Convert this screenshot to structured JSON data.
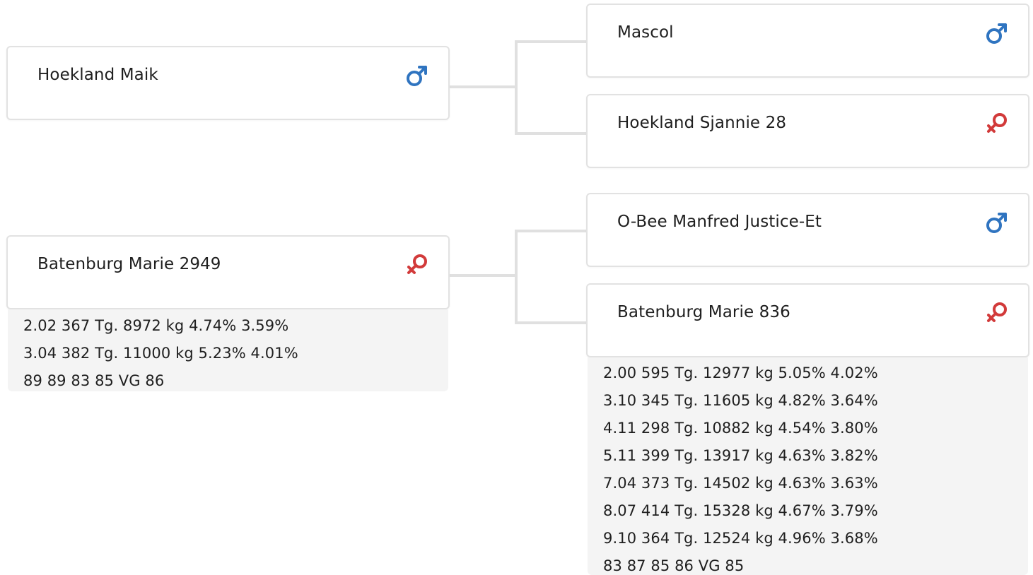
{
  "pedigree": {
    "sire": {
      "name": "Hoekland Maik",
      "sex_icon": "male-icon",
      "sire": {
        "name": "Mascol",
        "sex_icon": "male-icon"
      },
      "dam": {
        "name": "Hoekland Sjannie 28",
        "sex_icon": "female-icon"
      }
    },
    "dam": {
      "name": "Batenburg Marie 2949",
      "sex_icon": "female-icon",
      "stats": [
        "2.02 367 Tg. 8972 kg 4.74% 3.59%",
        "3.04 382 Tg. 11000 kg 5.23% 4.01%",
        "89 89 83 85 VG 86"
      ],
      "sire": {
        "name": "O-Bee Manfred Justice-Et",
        "sex_icon": "male-icon"
      },
      "dam": {
        "name": "Batenburg Marie 836",
        "sex_icon": "female-icon",
        "stats": [
          "2.00 595 Tg. 12977 kg 5.05% 4.02%",
          "3.10 345 Tg. 11605 kg 4.82% 3.64%",
          "4.11 298 Tg. 10882 kg 4.54% 3.80%",
          "5.11 399 Tg. 13917 kg 4.63% 3.82%",
          "7.04 373 Tg. 14502 kg 4.63% 3.63%",
          "8.07 414 Tg. 15328 kg 4.67% 3.79%",
          "9.10 364 Tg. 12524 kg 4.96% 3.68%",
          "83 87 85 86 VG 85"
        ]
      }
    }
  },
  "colors": {
    "male": "#2f74c0",
    "female": "#d23a3a",
    "border": "#e2e2e2",
    "connector": "#e0e0e0",
    "stats_bg": "#f4f4f4"
  }
}
